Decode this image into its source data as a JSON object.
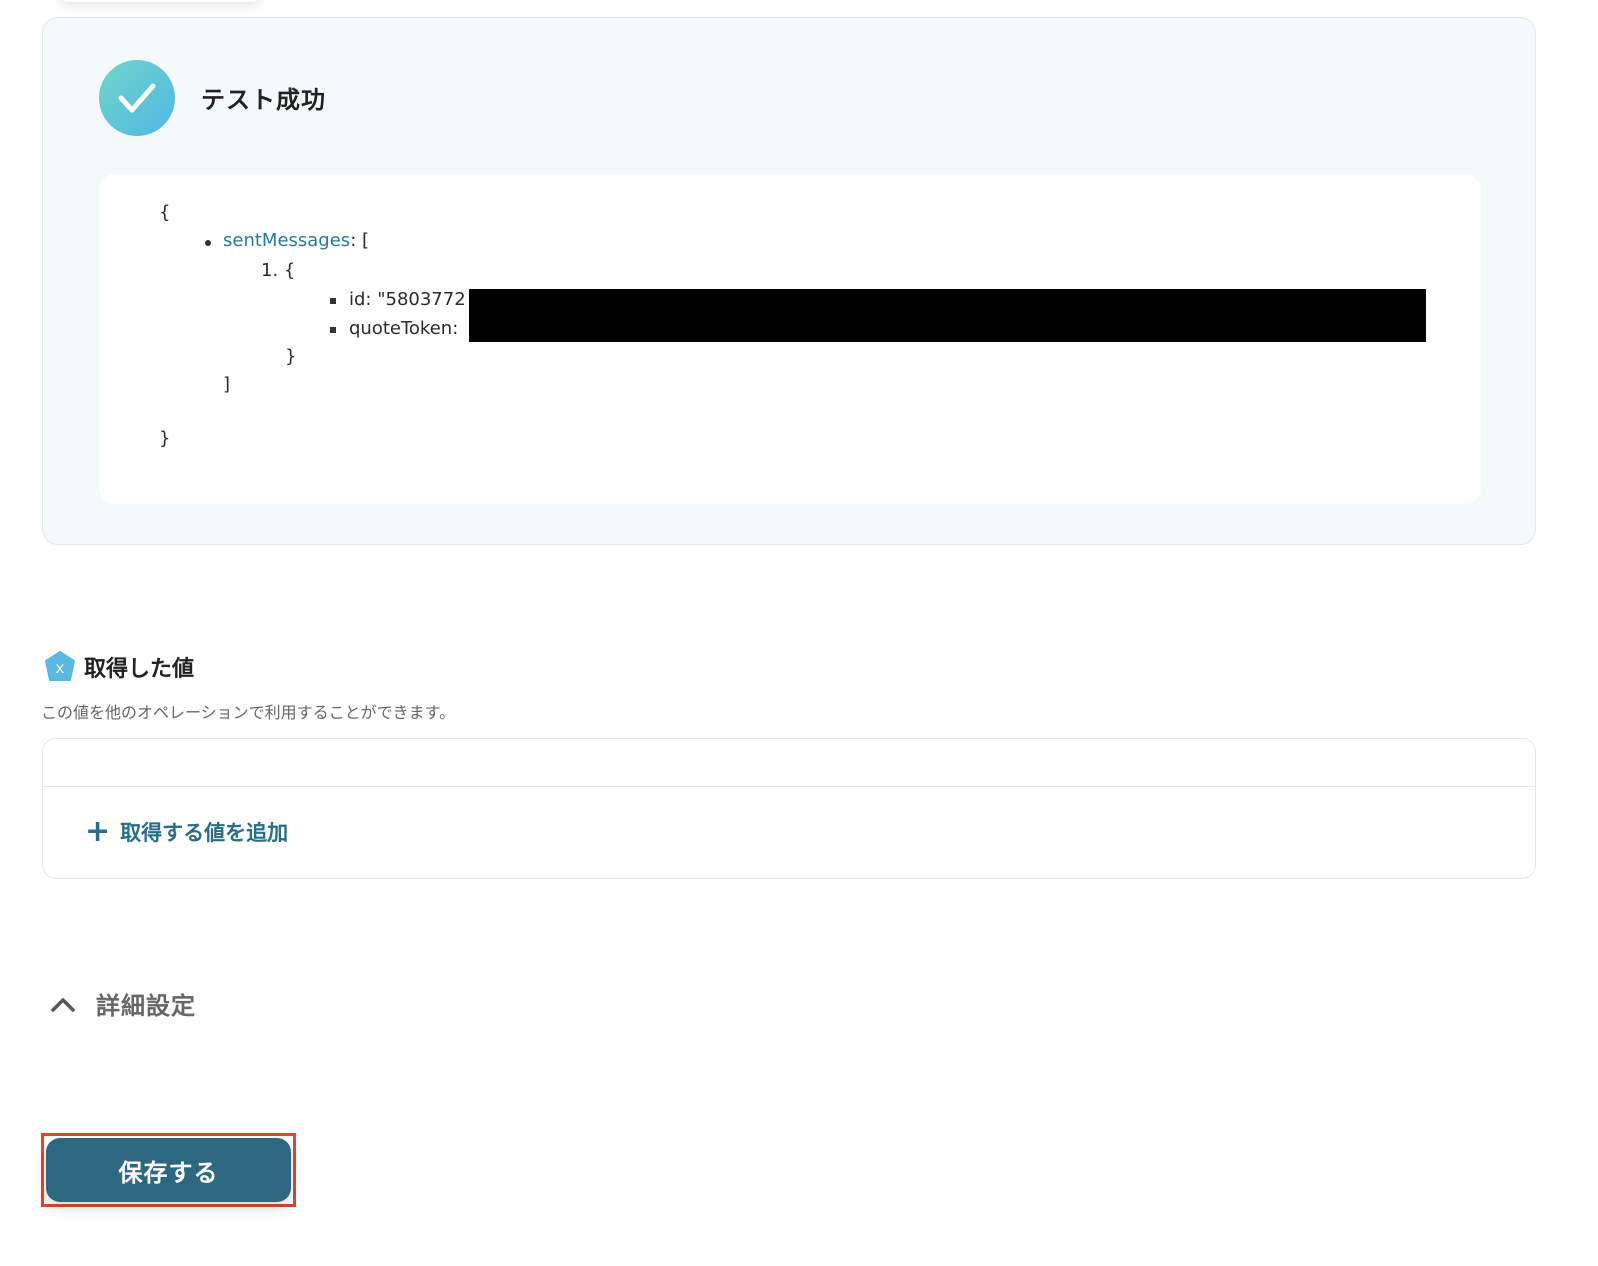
{
  "result": {
    "title": "テスト成功",
    "json": {
      "open_brace": "{",
      "key": "sentMessages",
      "after_key": ": [",
      "item_index": "1. {",
      "id_line": "id: \"5803772",
      "quote_token_line": "quoteToken:",
      "item_close": "}",
      "array_close": "]",
      "close_brace": "}"
    }
  },
  "values": {
    "title": "取得した値",
    "description": "この値を他のオペレーションで利用することができます。",
    "icon_letter": "x",
    "add_label": "取得する値を追加"
  },
  "advanced": {
    "label": "詳細設定"
  },
  "save": {
    "label": "保存する"
  },
  "colors": {
    "accent": "#2d6880",
    "link": "#2a6d86",
    "highlight": "#e8432d",
    "success_gradient_start": "#6fd6c7",
    "success_gradient_end": "#52b6e6"
  }
}
